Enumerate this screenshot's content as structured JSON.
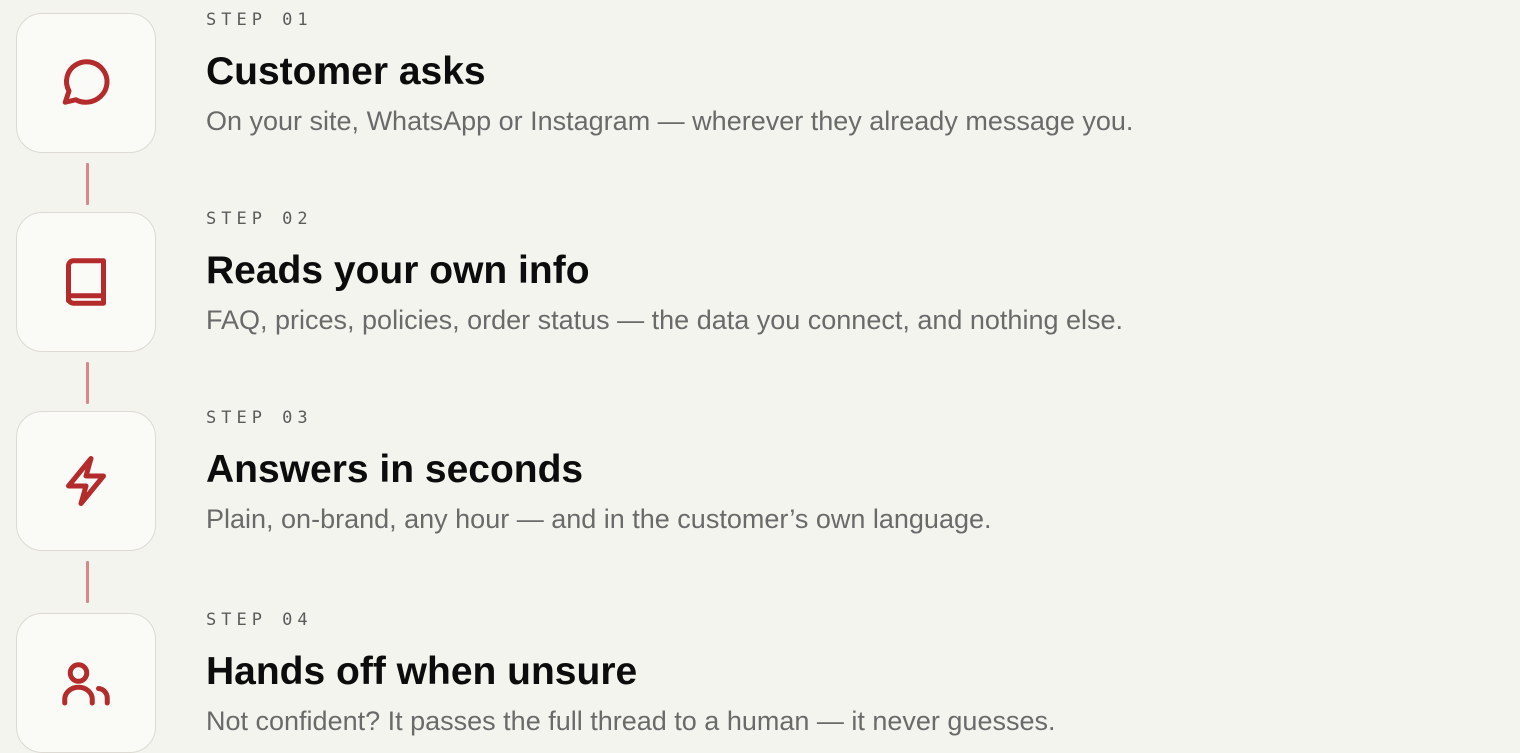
{
  "theme": {
    "background": "#f4f4ef",
    "accent": "#b32b2b",
    "connector": "#d9888a"
  },
  "steps": [
    {
      "number": "STEP 01",
      "title": "Customer asks",
      "description": "On your site, WhatsApp or Instagram — wherever they already message you.",
      "icon": "message-bubble-icon"
    },
    {
      "number": "STEP 02",
      "title": "Reads your own info",
      "description": "FAQ, prices, policies, order status — the data you connect, and nothing else.",
      "icon": "book-icon"
    },
    {
      "number": "STEP 03",
      "title": "Answers in seconds",
      "description": "Plain, on-brand, any hour — and in the customer’s own language.",
      "icon": "lightning-bolt-icon"
    },
    {
      "number": "STEP 04",
      "title": "Hands off when unsure",
      "description": "Not confident? It passes the full thread to a human — it never guesses.",
      "icon": "users-icon"
    }
  ]
}
